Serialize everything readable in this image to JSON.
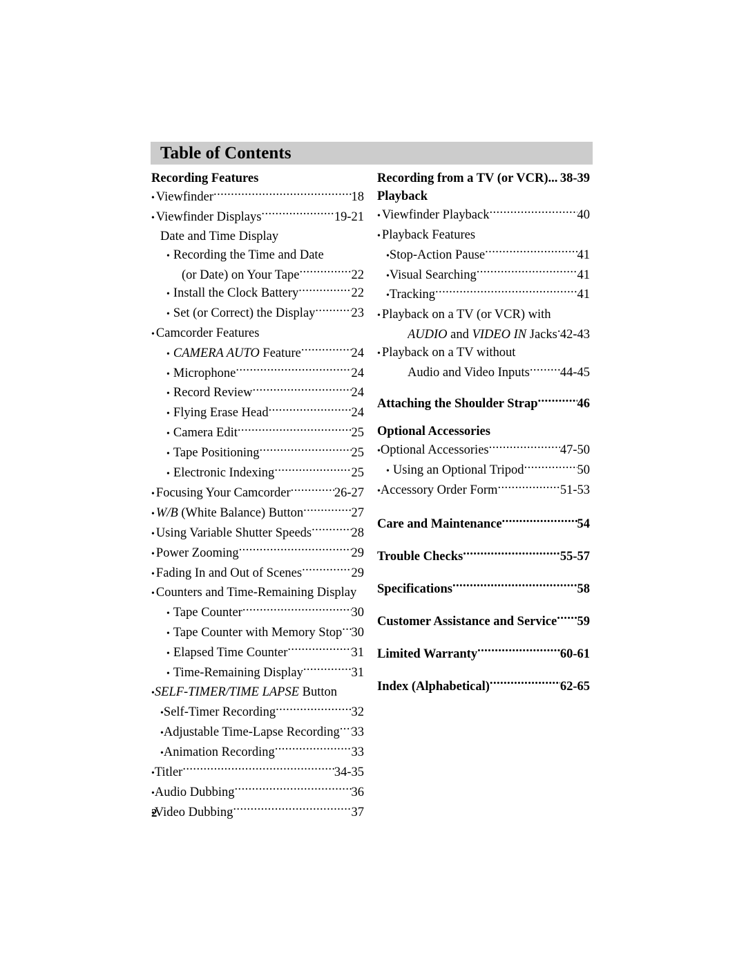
{
  "page": {
    "header_title": "Table of Contents",
    "page_number": "2",
    "header_bg_color": "#cccccc"
  },
  "left_column": [
    {
      "kind": "head",
      "indent": 0,
      "bullet": "",
      "label": "Recording Features",
      "page": "",
      "leader": false
    },
    {
      "kind": "entry",
      "indent": 0,
      "bullet": "•",
      "label": "Viewfinder",
      "page": "18",
      "leader": true
    },
    {
      "kind": "entry",
      "indent": 0,
      "bullet": "•",
      "label": "Viewfinder Displays ",
      "page": "19-21",
      "leader": true
    },
    {
      "kind": "entry",
      "indent": 2,
      "bullet": "",
      "label": "Date and Time Display",
      "page": "",
      "leader": false
    },
    {
      "kind": "entry",
      "indent": 1,
      "bullet": "•",
      "label": "Recording the Time and Date",
      "page": "",
      "leader": false,
      "bulletpad": "wide"
    },
    {
      "kind": "entry",
      "indent": 3,
      "bullet": "",
      "label": "(or Date) on Your Tape",
      "page": "22",
      "leader": true
    },
    {
      "kind": "entry",
      "indent": 1,
      "bullet": "•",
      "label": "Install the Clock Battery ",
      "page": "22",
      "leader": true,
      "bulletpad": "wide"
    },
    {
      "kind": "entry",
      "indent": 1,
      "bullet": "•",
      "label": "Set (or Correct) the Display",
      "page": "23",
      "leader": true,
      "bulletpad": "wide"
    },
    {
      "kind": "entry",
      "indent": 0,
      "bullet": "•",
      "label": "Camcorder Features",
      "page": "",
      "leader": false
    },
    {
      "kind": "entry",
      "indent": 1,
      "bullet": "•",
      "label_italic": "CAMERA AUTO",
      "label": " Feature ",
      "page": "24",
      "leader": true,
      "bulletpad": "wide"
    },
    {
      "kind": "entry",
      "indent": 1,
      "bullet": "•",
      "label": "Microphone",
      "page": "24",
      "leader": true,
      "bulletpad": "wide"
    },
    {
      "kind": "entry",
      "indent": 1,
      "bullet": "•",
      "label": "Record Review",
      "page": "24",
      "leader": true,
      "bulletpad": "wide"
    },
    {
      "kind": "entry",
      "indent": 1,
      "bullet": "•",
      "label": "Flying Erase Head",
      "page": "24",
      "leader": true,
      "bulletpad": "wide"
    },
    {
      "kind": "entry",
      "indent": 1,
      "bullet": "•",
      "label": "Camera Edit ",
      "page": "25",
      "leader": true,
      "bulletpad": "wide"
    },
    {
      "kind": "entry",
      "indent": 1,
      "bullet": "•",
      "label": "Tape Positioning ",
      "page": "25",
      "leader": true,
      "bulletpad": "wide"
    },
    {
      "kind": "entry",
      "indent": 1,
      "bullet": "•",
      "label": "Electronic Indexing",
      "page": "25",
      "leader": true,
      "bulletpad": "wide"
    },
    {
      "kind": "entry",
      "indent": 0,
      "bullet": "•",
      "label": "Focusing Your Camcorder ",
      "page": "26-27",
      "leader": true
    },
    {
      "kind": "entry",
      "indent": 0,
      "bullet": "•",
      "label_italic": "W/B",
      "label": " (White Balance) Button",
      "page": "27",
      "leader": true
    },
    {
      "kind": "entry",
      "indent": 0,
      "bullet": "•",
      "label": "Using Variable Shutter Speeds",
      "page": "28",
      "leader": true
    },
    {
      "kind": "entry",
      "indent": 0,
      "bullet": "•",
      "label": "Power Zooming ",
      "page": "29",
      "leader": true
    },
    {
      "kind": "entry",
      "indent": 0,
      "bullet": "•",
      "label": "Fading In and Out of Scenes ",
      "page": "29",
      "leader": true
    },
    {
      "kind": "entry",
      "indent": 0,
      "bullet": "•",
      "label": "Counters and Time-Remaining Display",
      "page": "",
      "leader": false
    },
    {
      "kind": "entry",
      "indent": 1,
      "bullet": "•",
      "label": "Tape Counter ",
      "page": "30",
      "leader": true,
      "bulletpad": "wide"
    },
    {
      "kind": "entry",
      "indent": 1,
      "bullet": "•",
      "label": "Tape Counter with Memory Stop ",
      "page": "30",
      "leader": true,
      "bulletpad": "wide"
    },
    {
      "kind": "entry",
      "indent": 1,
      "bullet": "•",
      "label": "Elapsed Time Counter ",
      "page": "31",
      "leader": true,
      "bulletpad": "wide"
    },
    {
      "kind": "entry",
      "indent": 1,
      "bullet": "•",
      "label": "Time-Remaining Display",
      "page": "31",
      "leader": true,
      "bulletpad": "wide"
    },
    {
      "kind": "entry",
      "indent": 0,
      "bullet": "•",
      "label_italic": "SELF-TIMER/TIME LAPSE",
      "label": " Button",
      "page": "",
      "leader": false,
      "bulletpad": "tight"
    },
    {
      "kind": "entry",
      "indent": 2,
      "bullet": "•",
      "label": "Self-Timer Recording ",
      "page": "32",
      "leader": true,
      "bulletpad": "tight"
    },
    {
      "kind": "entry",
      "indent": 2,
      "bullet": "•",
      "label": "Adjustable Time-Lapse Recording ",
      "page": "33",
      "leader": true,
      "bulletpad": "tight"
    },
    {
      "kind": "entry",
      "indent": 2,
      "bullet": "•",
      "label": "Animation Recording",
      "page": "33",
      "leader": true,
      "bulletpad": "tight"
    },
    {
      "kind": "entry",
      "indent": 0,
      "bullet": "•",
      "label": "Titler",
      "page": "34-35",
      "leader": true,
      "bulletpad": "tight"
    },
    {
      "kind": "entry",
      "indent": 0,
      "bullet": "•",
      "label": "Audio Dubbing",
      "page": "36",
      "leader": true,
      "bulletpad": "tight"
    },
    {
      "kind": "entry",
      "indent": 0,
      "bullet": "•",
      "label": "Video Dubbing ",
      "page": "37",
      "leader": true,
      "bulletpad": "tight"
    }
  ],
  "right_column": [
    {
      "kind": "head",
      "indent": 0,
      "bullet": "",
      "label": "Recording from a TV (or VCR)",
      "page": "38-39",
      "leader": true,
      "leaderdots": "..."
    },
    {
      "kind": "head",
      "indent": 0,
      "bullet": "",
      "label": "Playback",
      "page": "",
      "leader": false
    },
    {
      "kind": "entry",
      "indent": 0,
      "bullet": "•",
      "label": "Viewfinder Playback ",
      "page": "40",
      "leader": true
    },
    {
      "kind": "entry",
      "indent": 0,
      "bullet": "•",
      "label": "Playback Features",
      "page": "",
      "leader": false
    },
    {
      "kind": "entry",
      "indent": 2,
      "bullet": "•",
      "label": "Stop-Action Pause",
      "page": "41",
      "leader": true,
      "bulletpad": "tight"
    },
    {
      "kind": "entry",
      "indent": 2,
      "bullet": "•",
      "label": "Visual Searching ",
      "page": "41",
      "leader": true,
      "bulletpad": "tight"
    },
    {
      "kind": "entry",
      "indent": 2,
      "bullet": "•",
      "label": "Tracking ",
      "page": "41",
      "leader": true,
      "bulletpad": "tight"
    },
    {
      "kind": "entry",
      "indent": 0,
      "bullet": "•",
      "label": "Playback on a TV (or VCR) with",
      "page": "",
      "leader": false
    },
    {
      "kind": "entry",
      "indent": 3,
      "bullet": "",
      "label_italic": "AUDIO",
      "label": " and ",
      "label_italic2": "VIDEO IN",
      "label2": " Jacks",
      "page": "42-43",
      "leader": true
    },
    {
      "kind": "entry",
      "indent": 0,
      "bullet": "•",
      "label": "Playback on a TV without",
      "page": "",
      "leader": false
    },
    {
      "kind": "entry",
      "indent": 3,
      "bullet": "",
      "label": "Audio and Video Inputs",
      "page": "44-45",
      "leader": true
    },
    {
      "kind": "head",
      "indent": 0,
      "bullet": "",
      "label": "Attaching the Shoulder Strap",
      "page": "46",
      "leader": true
    },
    {
      "kind": "head",
      "indent": 0,
      "bullet": "",
      "label": "Optional Accessories",
      "page": "",
      "leader": false
    },
    {
      "kind": "entry",
      "indent": 0,
      "bullet": "•",
      "label": "Optional Accessories ",
      "page": "47-50",
      "leader": true,
      "bulletpad": "tight"
    },
    {
      "kind": "entry",
      "indent": 2,
      "bullet": "•",
      "label": "Using an Optional Tripod ",
      "page": "50",
      "leader": true,
      "bulletpad": "wide"
    },
    {
      "kind": "entry",
      "indent": 0,
      "bullet": "•",
      "label": "Accessory Order Form",
      "page": "51-53",
      "leader": true,
      "bulletpad": "tight"
    },
    {
      "kind": "head",
      "indent": 0,
      "bullet": "",
      "label": "Care and Maintenance",
      "page": "54",
      "leader": true
    },
    {
      "kind": "head",
      "indent": 0,
      "bullet": "",
      "label": "Trouble Checks ",
      "page": "55-57",
      "leader": true
    },
    {
      "kind": "head",
      "indent": 0,
      "bullet": "",
      "label": "Specifications ",
      "page": "58",
      "leader": true
    },
    {
      "kind": "head",
      "indent": 0,
      "bullet": "",
      "label": "Customer Assistance and Service ",
      "page": "59",
      "leader": true
    },
    {
      "kind": "head",
      "indent": 0,
      "bullet": "",
      "label": "Limited Warranty",
      "page": "60-61",
      "leader": true
    },
    {
      "kind": "head",
      "indent": 0,
      "bullet": "",
      "label": "Index (Alphabetical) ",
      "page": "62-65",
      "leader": true
    }
  ],
  "right_column_gaps": {
    "11": 18,
    "12": 14,
    "16": 20,
    "17": 20,
    "18": 20,
    "19": 20,
    "20": 20,
    "21": 20
  }
}
